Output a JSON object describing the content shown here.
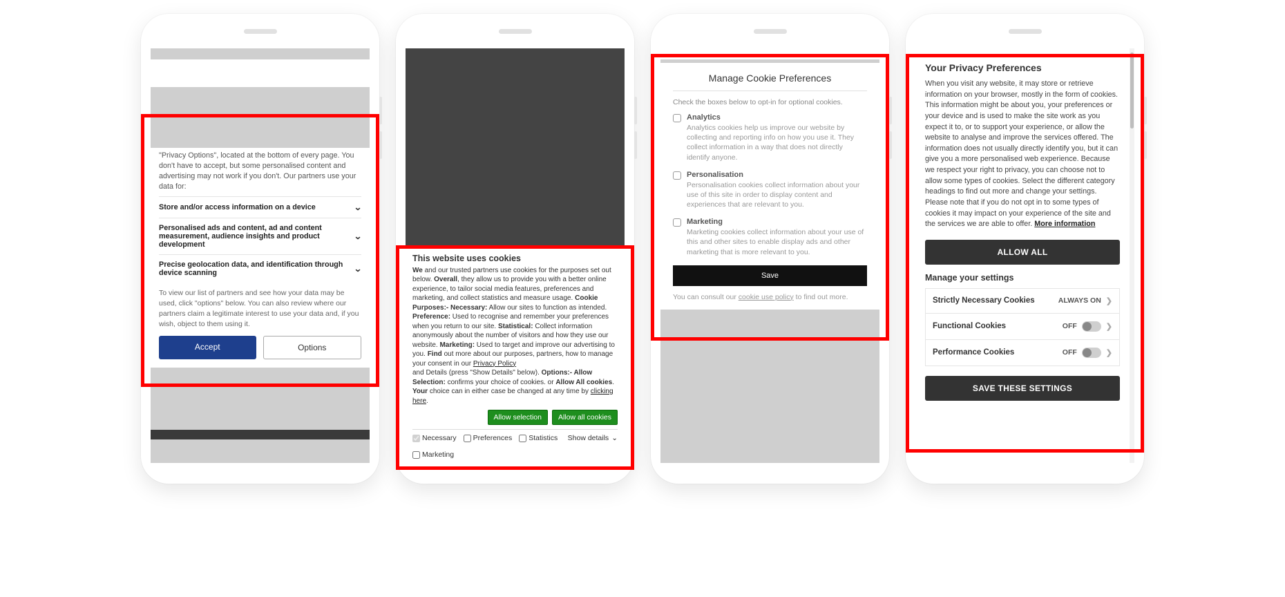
{
  "phone1": {
    "intro": "\"Privacy Options\", located at the bottom of every page. You don't have to accept, but some personalised content and advertising may not work if you don't. Our partners use your data for:",
    "acc1": "Store and/or access information on a device",
    "acc2": "Personalised ads and content, ad and content measurement, audience insights and product development",
    "acc3": "Precise geolocation data, and identification through device scanning",
    "footnote": "To view our list of partners and see how your data may be used, click \"options\" below. You can also review where our partners claim a legitimate interest to use your data and, if you wish, object to them using it.",
    "accept": "Accept",
    "options": "Options"
  },
  "phone2": {
    "title": "This website uses cookies",
    "body_pre_we": "We",
    "body_1": " and our trusted partners use cookies for the purposes set out below. ",
    "body_overall": "Overall",
    "body_2": ", they allow us to provide you with a better online experience, to tailor social media features, preferences and marketing, and collect statistics and measure usage. ",
    "body_cp": "Cookie Purposes:- Necessary:",
    "body_3": " Allow our sites to function as intended. ",
    "body_pref": "Preference:",
    "body_4": " Used to recognise and remember your preferences when you return to our site. ",
    "body_stat": "Statistical:",
    "body_5": " Collect information anonymously about the number of visitors and how they use our website. ",
    "body_mkt": "Marketing:",
    "body_6": " Used to target and improve our advertising to you. ",
    "body_find": "Find",
    "body_7": " out more about our purposes, partners, how to manage your consent in our ",
    "privacy_link": "Privacy Policy",
    "body_8": " and Details (press \"Show Details\" below). ",
    "body_opt": "Options:- Allow Selection:",
    "body_9": " confirms your choice of cookies. or ",
    "body_allow": "Allow All cookies",
    "body_10": ". ",
    "body_your": "Your",
    "body_11": " choice can in either case be changed at any time by ",
    "click_link": "clicking here",
    "body_12": ".",
    "btn_sel": "Allow selection",
    "btn_all": "Allow all cookies",
    "chk_nec": "Necessary",
    "chk_pref": "Preferences",
    "chk_stat": "Statistics",
    "chk_mkt": "Marketing",
    "show_details": "Show details"
  },
  "phone3": {
    "title": "Manage Cookie Preferences",
    "hint": "Check the boxes below to opt-in for optional cookies.",
    "analytics_l": "Analytics",
    "analytics_d": "Analytics cookies help us improve our website by collecting and reporting info on how you use it. They collect information in a way that does not directly identify anyone.",
    "pers_l": "Personalisation",
    "pers_d": "Personalisation cookies collect information about your use of this site in order to display content and experiences that are relevant to you.",
    "mkt_l": "Marketing",
    "mkt_d": "Marketing cookies collect information about your use of this and other sites to enable display ads and other marketing that is more relevant to you.",
    "save": "Save",
    "policy_pre": "You can consult our ",
    "policy_link": "cookie use policy",
    "policy_post": " to find out more."
  },
  "phone4": {
    "title": "Your Privacy Preferences",
    "body": "When you visit any website, it may store or retrieve information on your browser, mostly in the form of cookies. This information might be about you, your preferences or your device and is used to make the site work as you expect it to, or to support your experience, or allow the website to analyse and improve the services offered. The information does not usually directly identify you, but it can give you a more personalised web experience. Because we respect your right to privacy, you can choose not to allow some types of cookies. Select the different category headings to find out more and change your settings. Please note that if you do not opt in to some types of cookies it may impact on your experience of the site and the services we are able to offer.  ",
    "more_info": "More information",
    "allow_all": "ALLOW ALL",
    "manage": "Manage your settings",
    "row1": "Strictly Necessary Cookies",
    "row1_state": "ALWAYS ON",
    "row2": "Functional Cookies",
    "row3": "Performance Cookies",
    "off": "OFF",
    "save": "SAVE THESE SETTINGS"
  }
}
